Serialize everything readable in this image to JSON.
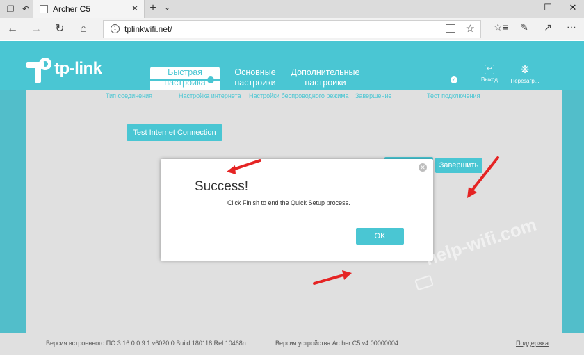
{
  "browser": {
    "tab_title": "Archer C5",
    "url": "tplinkwifi.net/"
  },
  "brand": {
    "name": "tp-link",
    "accent": "#4ac6d3"
  },
  "topnav": [
    {
      "label": "Быстрая настройка",
      "active": true
    },
    {
      "label": "Основные настройки",
      "active": false
    },
    {
      "label": "Дополнительные настройки",
      "active": false
    }
  ],
  "header_actions": {
    "logout": "Выход",
    "reboot": "Перезагр..."
  },
  "steps": [
    {
      "label": "Тип соединения"
    },
    {
      "label": "Настройка интернета"
    },
    {
      "label": "Настройки беспроводного режима"
    },
    {
      "label": "Завершение"
    },
    {
      "label": "Тест подключения"
    }
  ],
  "buttons": {
    "test": "Test Internet Connection",
    "finish": "Завершить"
  },
  "dialog": {
    "title": "Success!",
    "message": "Click Finish to end the Quick Setup process.",
    "ok": "OK"
  },
  "footer": {
    "firmware": "Версия встроенного ПО:3.16.0 0.9.1 v6020.0 Build 180118 Rel.10468n",
    "hardware": "Версия устройства:Archer C5 v4 00000004",
    "support": "Поддержка"
  },
  "watermark": "help-wifi.com"
}
